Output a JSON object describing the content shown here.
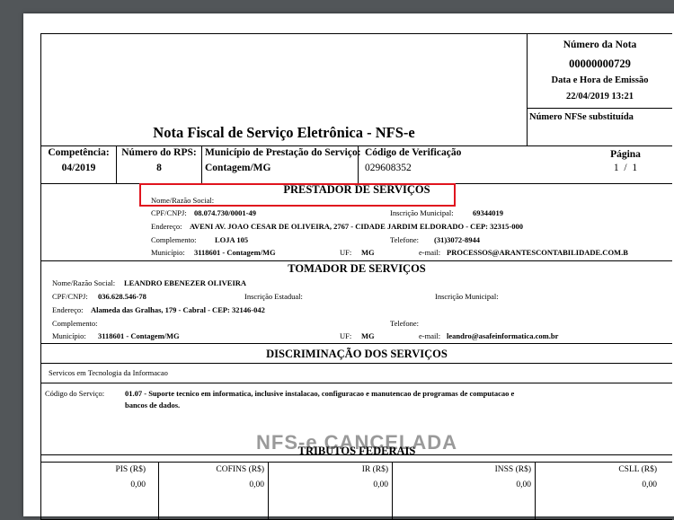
{
  "header": {
    "title": "Nota Fiscal de Serviço Eletrônica - NFS-e",
    "numero_label": "Número da Nota",
    "numero_value": "00000000729",
    "data_label": "Data e Hora de Emissão",
    "data_value": "22/04/2019 13:21",
    "substituida_label": "Número NFSe substituída"
  },
  "info_row": {
    "competencia_label": "Competência:",
    "competencia_value": "04/2019",
    "rps_label": "Número do RPS:",
    "rps_value": "8",
    "municipio_label": "Município de Prestação do Serviço:",
    "municipio_value": "Contagem/MG",
    "codigo_label": "Código de Verificação",
    "codigo_value": "029608352",
    "pagina_label": "Página",
    "pagina_value": "1  /  1"
  },
  "prestador": {
    "title": "PRESTADOR DE SERVIÇOS",
    "nome_label": "Nome/Razão Social:",
    "cpf_label": "CPF/CNPJ:",
    "cpf_value": "08.074.730/0001-49",
    "im_label": "Inscrição Municipal:",
    "im_value": "69344019",
    "endereco_label": "Endereço:",
    "endereco_value": "AVENI AV. JOAO CESAR DE OLIVEIRA, 2767 - CIDADE JARDIM ELDORADO - CEP: 32315-000",
    "complemento_label": "Complemento:",
    "complemento_value": "LOJA 105",
    "telefone_label": "Telefone:",
    "telefone_value": "(31)3072-8944",
    "municipio_label": "Município:",
    "municipio_value": "3118601 - Contagem/MG",
    "uf_label": "UF:",
    "uf_value": "MG",
    "email_label": "e-mail:",
    "email_value": "PROCESSOS@ARANTESCONTABILIDADE.COM.B"
  },
  "tomador": {
    "title": "TOMADOR DE SERVIÇOS",
    "nome_label": "Nome/Razão Social:",
    "nome_value": "LEANDRO EBENEZER OLIVEIRA",
    "cpf_label": "CPF/CNPJ:",
    "cpf_value": "036.628.546-78",
    "ie_label": "Inscrição Estadual:",
    "im_label": "Inscrição Municipal:",
    "endereco_label": "Endereço:",
    "endereco_value": "Alameda das Gralhas, 179 - Cabral - CEP: 32146-042",
    "complemento_label": "Complemento:",
    "telefone_label": "Telefone:",
    "municipio_label": "Município:",
    "municipio_value": "3118601 - Contagem/MG",
    "uf_label": "UF:",
    "uf_value": "MG",
    "email_label": "e-mail:",
    "email_value": "leandro@asafeinformatica.com.br"
  },
  "discriminacao": {
    "title": "DISCRIMINAÇÃO DOS SERVIÇOS",
    "text": "Servicos em Tecnologia da Informacao"
  },
  "servico": {
    "label": "Código do Serviço:",
    "value_line1": "01.07 - Suporte tecnico em informatica, inclusive instalacao, configuracao e manutencao de programas de computacao e",
    "value_line2": "bancos de dados."
  },
  "watermark": "NFS-e CANCELADA",
  "tributos": {
    "title": "TRIBUTOS FEDERAIS",
    "items": [
      {
        "label": "PIS (R$)",
        "value": "0,00"
      },
      {
        "label": "COFINS (R$)",
        "value": "0,00"
      },
      {
        "label": "IR (R$)",
        "value": "0,00"
      },
      {
        "label": "INSS (R$)",
        "value": "0,00"
      },
      {
        "label": "CSLL (R$)",
        "value": "0,00"
      }
    ]
  },
  "colors": {
    "highlight": "#e0141e",
    "viewer_background": "#525659",
    "watermark": "#9a9a9a"
  }
}
